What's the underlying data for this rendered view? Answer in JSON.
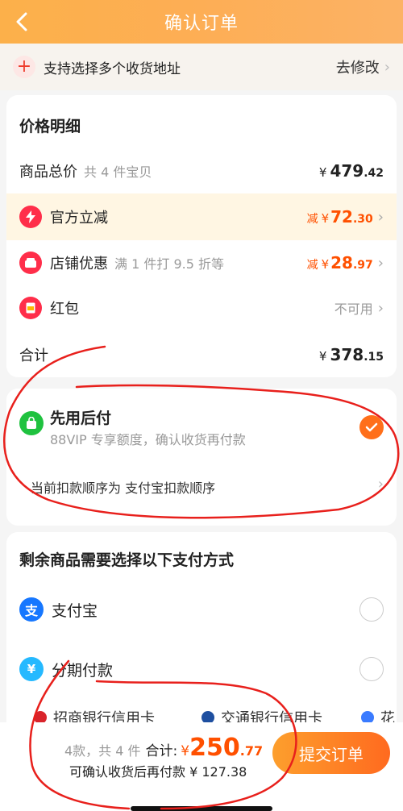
{
  "header": {
    "title": "确认订单"
  },
  "address": {
    "label": "支持选择多个收货地址",
    "action": "去修改"
  },
  "price_detail": {
    "title": "价格明细",
    "goods_total": {
      "label": "商品总价",
      "sub": "共 4 件宝贝",
      "yen": "¥",
      "int": "479",
      "dec": ".42"
    },
    "official": {
      "label": "官方立减",
      "tag": "减",
      "yen": "¥",
      "int": "72",
      "dec": ".30"
    },
    "shop": {
      "label": "店铺优惠",
      "sub": "满 1 件打 9.5 折等",
      "tag": "减",
      "yen": "¥",
      "int": "28",
      "dec": ".97"
    },
    "hongbao": {
      "label": "红包",
      "status": "不可用"
    },
    "sum": {
      "label": "合计",
      "yen": "¥",
      "int": "378",
      "dec": ".15"
    }
  },
  "pay_later": {
    "title": "先用后付",
    "sub": "88VIP 专享额度，确认收货再付款",
    "order_text": "当前扣款顺序为 支付宝扣款顺序"
  },
  "payment": {
    "title": "剩余商品需要选择以下支付方式",
    "methods": [
      {
        "label": "支付宝"
      },
      {
        "label": "分期付款"
      }
    ],
    "banks": [
      "招商银行信用卡",
      "交通银行信用卡",
      "花"
    ]
  },
  "bottom": {
    "count": "4款，共 4 件",
    "total_label": "合计:",
    "yen": "¥",
    "int": "250",
    "dec": ".77",
    "pay_after": "可确认收货后再付款 ¥ 127.38",
    "submit": "提交订单"
  },
  "colors": {
    "accent": "#ff5000",
    "header": "#fdae55",
    "green": "#1fc23f"
  }
}
